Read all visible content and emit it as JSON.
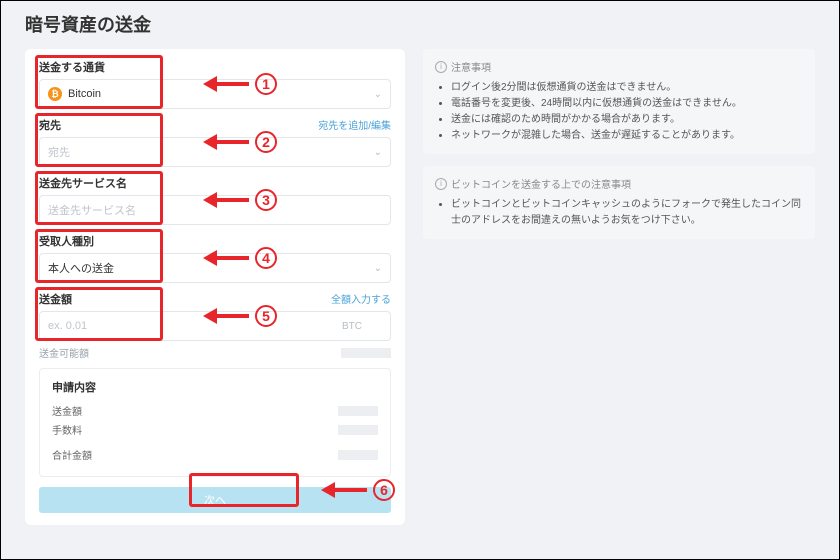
{
  "page_title": "暗号資産の送金",
  "fields": {
    "currency": {
      "label": "送金する通貨",
      "value": "Bitcoin",
      "icon": "bitcoin-icon"
    },
    "destination": {
      "label": "宛先",
      "placeholder": "宛先",
      "link": "宛先を追加/編集"
    },
    "service": {
      "label": "送金先サービス名",
      "placeholder": "送金先サービス名"
    },
    "recipient_type": {
      "label": "受取人種別",
      "value": "本人への送金"
    },
    "amount": {
      "label": "送金額",
      "placeholder": "ex. 0.01",
      "link": "全額入力する",
      "unit": "BTC",
      "subtext": "送金可能額"
    }
  },
  "summary": {
    "title": "申請内容",
    "rows": {
      "send": "送金額",
      "fee": "手数料",
      "total": "合計金額"
    }
  },
  "next_button": "次へ",
  "notice1": {
    "title": "注意事項",
    "items": [
      "ログイン後2分間は仮想通貨の送金はできません。",
      "電話番号を変更後、24時間以内に仮想通貨の送金はできません。",
      "送金には確認のため時間がかかる場合があります。",
      "ネットワークが混雑した場合、送金が遅延することがあります。"
    ]
  },
  "notice2": {
    "title": "ビットコインを送金する上での注意事項",
    "items": [
      "ビットコインとビットコインキャッシュのようにフォークで発生したコイン同士のアドレスをお間違えの無いようお気をつけ下さい。"
    ]
  },
  "annotations": [
    "1",
    "2",
    "3",
    "4",
    "5",
    "6"
  ]
}
